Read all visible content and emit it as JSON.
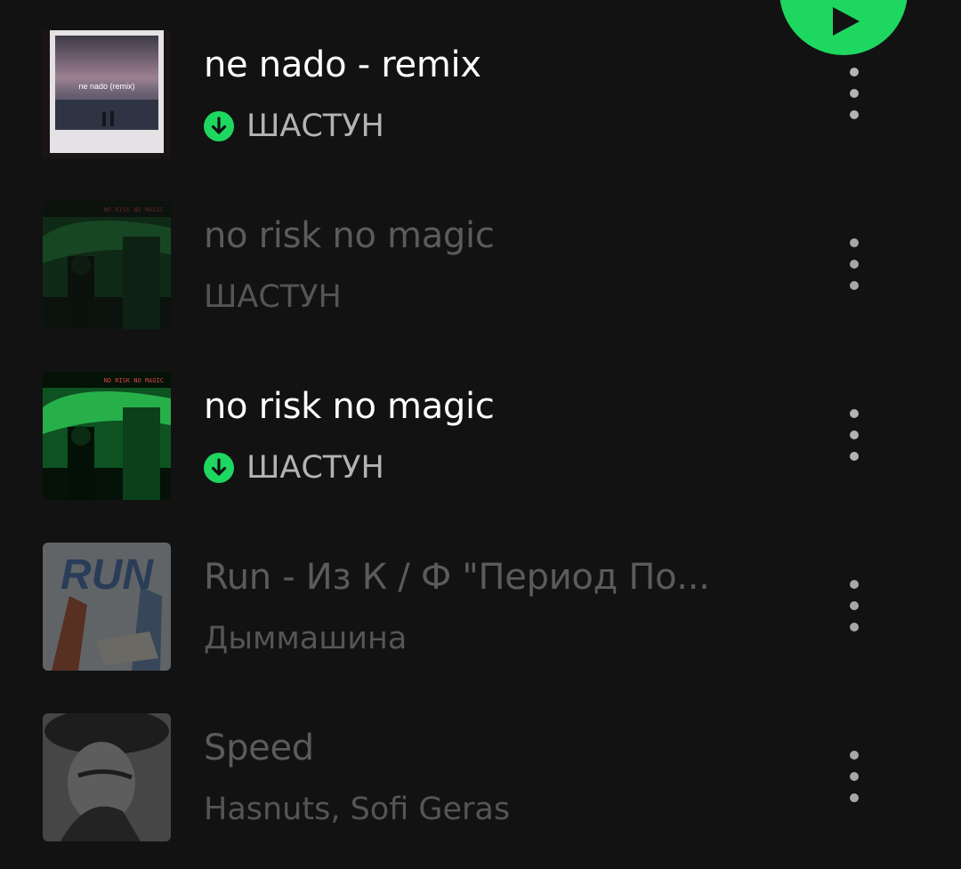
{
  "colors": {
    "background": "#121212",
    "accent": "#1ed760",
    "title_active": "#ffffff",
    "subtitle_active": "#b3b3b3",
    "text_unavailable": "#5b5b5b"
  },
  "play_button": {
    "icon": "play-icon"
  },
  "tracks": [
    {
      "title": "ne nado - remix",
      "artist": "ШАСТУН",
      "cover_text": "ne nado (remix)",
      "downloaded": true,
      "available": true,
      "more_icon": "more-vertical-icon"
    },
    {
      "title": "no risk no magic",
      "artist": "ШАСТУН",
      "cover_text": "NO RISK NO MAGIC",
      "downloaded": false,
      "available": false,
      "more_icon": "more-vertical-icon"
    },
    {
      "title": "no risk no magic",
      "artist": "ШАСТУН",
      "cover_text": "NO RISK NO MAGIC",
      "downloaded": true,
      "available": true,
      "more_icon": "more-vertical-icon"
    },
    {
      "title": "Run - Из К / Ф \"Период По...",
      "artist": "Дыммашина",
      "cover_text": "RUN",
      "downloaded": false,
      "available": false,
      "more_icon": "more-vertical-icon"
    },
    {
      "title": "Speed",
      "artist": "Hasnuts, Sofi Geras",
      "cover_text": "",
      "downloaded": false,
      "available": false,
      "more_icon": "more-vertical-icon"
    }
  ]
}
